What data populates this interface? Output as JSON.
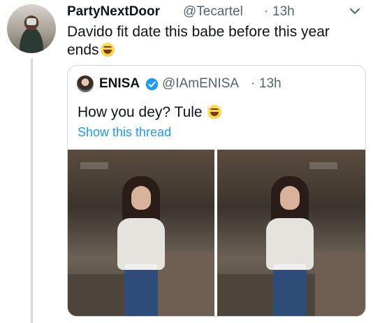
{
  "tweet": {
    "name": "PartyNextDoor",
    "handle": "@Tecartel",
    "dot": "·",
    "time": "13h",
    "text": "Davido fit date this babe before this year ends",
    "emoji": "grinning-sweat-emoji"
  },
  "quoted": {
    "name": "ENISA",
    "handle": "@IAmENISA",
    "dot": "·",
    "time": "13h",
    "text": "How you dey? Tule",
    "emoji": "grinning-sweat-emoji",
    "show_thread": "Show this thread",
    "photos": [
      "left-photo",
      "right-photo"
    ]
  },
  "icons": {
    "chevron": "chevron-down-icon",
    "verified": "verified-badge-icon"
  },
  "colors": {
    "link": "#1d9bf0",
    "muted": "#536471",
    "border": "#cfd9de",
    "verified": "#1d9bf0"
  }
}
